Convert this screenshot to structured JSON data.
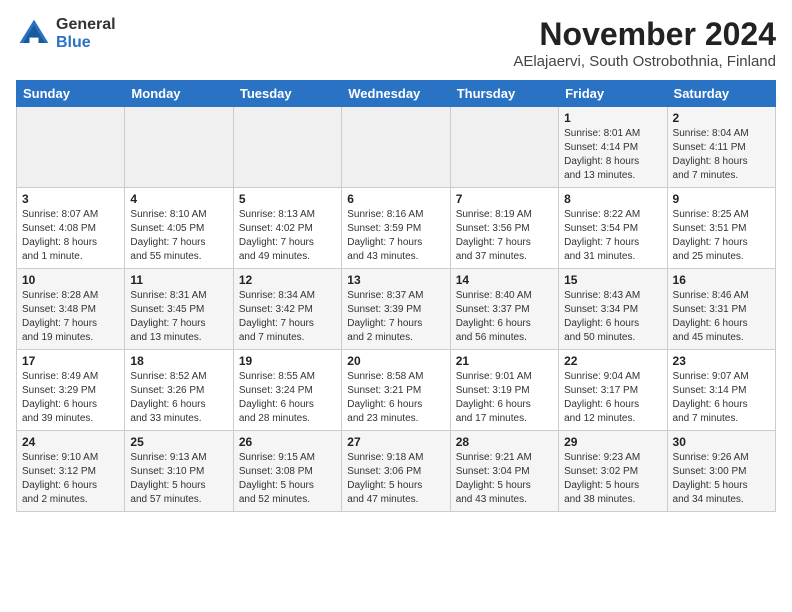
{
  "header": {
    "logo_general": "General",
    "logo_blue": "Blue",
    "month_title": "November 2024",
    "location": "AElajaervi, South Ostrobothnia, Finland"
  },
  "calendar": {
    "days_of_week": [
      "Sunday",
      "Monday",
      "Tuesday",
      "Wednesday",
      "Thursday",
      "Friday",
      "Saturday"
    ],
    "weeks": [
      [
        {
          "day": "",
          "info": ""
        },
        {
          "day": "",
          "info": ""
        },
        {
          "day": "",
          "info": ""
        },
        {
          "day": "",
          "info": ""
        },
        {
          "day": "",
          "info": ""
        },
        {
          "day": "1",
          "info": "Sunrise: 8:01 AM\nSunset: 4:14 PM\nDaylight: 8 hours\nand 13 minutes."
        },
        {
          "day": "2",
          "info": "Sunrise: 8:04 AM\nSunset: 4:11 PM\nDaylight: 8 hours\nand 7 minutes."
        }
      ],
      [
        {
          "day": "3",
          "info": "Sunrise: 8:07 AM\nSunset: 4:08 PM\nDaylight: 8 hours\nand 1 minute."
        },
        {
          "day": "4",
          "info": "Sunrise: 8:10 AM\nSunset: 4:05 PM\nDaylight: 7 hours\nand 55 minutes."
        },
        {
          "day": "5",
          "info": "Sunrise: 8:13 AM\nSunset: 4:02 PM\nDaylight: 7 hours\nand 49 minutes."
        },
        {
          "day": "6",
          "info": "Sunrise: 8:16 AM\nSunset: 3:59 PM\nDaylight: 7 hours\nand 43 minutes."
        },
        {
          "day": "7",
          "info": "Sunrise: 8:19 AM\nSunset: 3:56 PM\nDaylight: 7 hours\nand 37 minutes."
        },
        {
          "day": "8",
          "info": "Sunrise: 8:22 AM\nSunset: 3:54 PM\nDaylight: 7 hours\nand 31 minutes."
        },
        {
          "day": "9",
          "info": "Sunrise: 8:25 AM\nSunset: 3:51 PM\nDaylight: 7 hours\nand 25 minutes."
        }
      ],
      [
        {
          "day": "10",
          "info": "Sunrise: 8:28 AM\nSunset: 3:48 PM\nDaylight: 7 hours\nand 19 minutes."
        },
        {
          "day": "11",
          "info": "Sunrise: 8:31 AM\nSunset: 3:45 PM\nDaylight: 7 hours\nand 13 minutes."
        },
        {
          "day": "12",
          "info": "Sunrise: 8:34 AM\nSunset: 3:42 PM\nDaylight: 7 hours\nand 7 minutes."
        },
        {
          "day": "13",
          "info": "Sunrise: 8:37 AM\nSunset: 3:39 PM\nDaylight: 7 hours\nand 2 minutes."
        },
        {
          "day": "14",
          "info": "Sunrise: 8:40 AM\nSunset: 3:37 PM\nDaylight: 6 hours\nand 56 minutes."
        },
        {
          "day": "15",
          "info": "Sunrise: 8:43 AM\nSunset: 3:34 PM\nDaylight: 6 hours\nand 50 minutes."
        },
        {
          "day": "16",
          "info": "Sunrise: 8:46 AM\nSunset: 3:31 PM\nDaylight: 6 hours\nand 45 minutes."
        }
      ],
      [
        {
          "day": "17",
          "info": "Sunrise: 8:49 AM\nSunset: 3:29 PM\nDaylight: 6 hours\nand 39 minutes."
        },
        {
          "day": "18",
          "info": "Sunrise: 8:52 AM\nSunset: 3:26 PM\nDaylight: 6 hours\nand 33 minutes."
        },
        {
          "day": "19",
          "info": "Sunrise: 8:55 AM\nSunset: 3:24 PM\nDaylight: 6 hours\nand 28 minutes."
        },
        {
          "day": "20",
          "info": "Sunrise: 8:58 AM\nSunset: 3:21 PM\nDaylight: 6 hours\nand 23 minutes."
        },
        {
          "day": "21",
          "info": "Sunrise: 9:01 AM\nSunset: 3:19 PM\nDaylight: 6 hours\nand 17 minutes."
        },
        {
          "day": "22",
          "info": "Sunrise: 9:04 AM\nSunset: 3:17 PM\nDaylight: 6 hours\nand 12 minutes."
        },
        {
          "day": "23",
          "info": "Sunrise: 9:07 AM\nSunset: 3:14 PM\nDaylight: 6 hours\nand 7 minutes."
        }
      ],
      [
        {
          "day": "24",
          "info": "Sunrise: 9:10 AM\nSunset: 3:12 PM\nDaylight: 6 hours\nand 2 minutes."
        },
        {
          "day": "25",
          "info": "Sunrise: 9:13 AM\nSunset: 3:10 PM\nDaylight: 5 hours\nand 57 minutes."
        },
        {
          "day": "26",
          "info": "Sunrise: 9:15 AM\nSunset: 3:08 PM\nDaylight: 5 hours\nand 52 minutes."
        },
        {
          "day": "27",
          "info": "Sunrise: 9:18 AM\nSunset: 3:06 PM\nDaylight: 5 hours\nand 47 minutes."
        },
        {
          "day": "28",
          "info": "Sunrise: 9:21 AM\nSunset: 3:04 PM\nDaylight: 5 hours\nand 43 minutes."
        },
        {
          "day": "29",
          "info": "Sunrise: 9:23 AM\nSunset: 3:02 PM\nDaylight: 5 hours\nand 38 minutes."
        },
        {
          "day": "30",
          "info": "Sunrise: 9:26 AM\nSunset: 3:00 PM\nDaylight: 5 hours\nand 34 minutes."
        }
      ]
    ]
  }
}
